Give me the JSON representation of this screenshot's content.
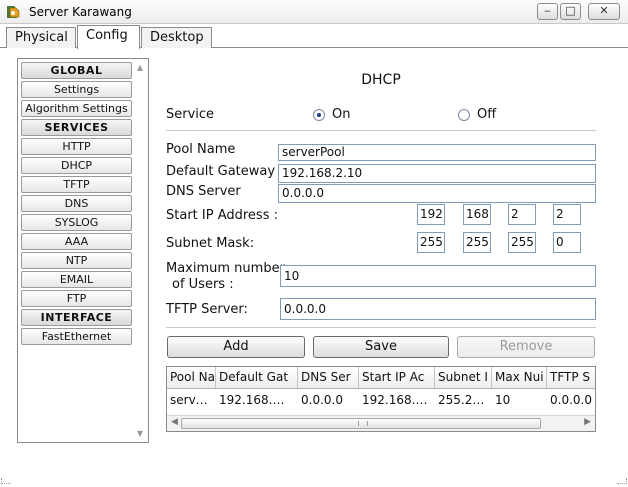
{
  "window": {
    "title": "Server Karawang",
    "icon": "server-app-icon",
    "controls": {
      "minimize": "‒",
      "maximize": "□",
      "close": "✕"
    }
  },
  "tabs": [
    "Physical",
    "Config",
    "Desktop"
  ],
  "active_tab": "Config",
  "sidebar": {
    "items": [
      {
        "label": "GLOBAL",
        "type": "header"
      },
      {
        "label": "Settings",
        "type": "item"
      },
      {
        "label": "Algorithm Settings",
        "type": "item"
      },
      {
        "label": "SERVICES",
        "type": "header"
      },
      {
        "label": "HTTP",
        "type": "item"
      },
      {
        "label": "DHCP",
        "type": "item"
      },
      {
        "label": "TFTP",
        "type": "item"
      },
      {
        "label": "DNS",
        "type": "item"
      },
      {
        "label": "SYSLOG",
        "type": "item"
      },
      {
        "label": "AAA",
        "type": "item"
      },
      {
        "label": "NTP",
        "type": "item"
      },
      {
        "label": "EMAIL",
        "type": "item"
      },
      {
        "label": "FTP",
        "type": "item"
      },
      {
        "label": "INTERFACE",
        "type": "header"
      },
      {
        "label": "FastEthernet",
        "type": "item"
      }
    ]
  },
  "dhcp": {
    "heading": "DHCP",
    "service_label": "Service",
    "on_label": "On",
    "off_label": "Off",
    "service_state": "On",
    "pool_name_label": "Pool Name",
    "pool_name": "serverPool",
    "gateway_label": "Default Gateway",
    "gateway": "192.168.2.10",
    "dns_label": "DNS Server",
    "dns": "0.0.0.0",
    "start_ip_label": "Start IP Address :",
    "start_ip": [
      "192",
      "168",
      "2",
      "2"
    ],
    "subnet_label": "Subnet Mask:",
    "subnet": [
      "255",
      "255",
      "255",
      "0"
    ],
    "max_users_label_1": "Maximum number",
    "max_users_label_2": "of Users :",
    "max_users": "10",
    "tftp_label": "TFTP Server:",
    "tftp": "0.0.0.0",
    "buttons": {
      "add": "Add",
      "save": "Save",
      "remove": "Remove"
    }
  },
  "table": {
    "columns": [
      "Pool Na",
      "Default Gat",
      "DNS Ser",
      "Start IP Ac",
      "Subnet I",
      "Max Nui",
      "TFTP S"
    ],
    "rows": [
      [
        "serv…",
        "192.168.…",
        "0.0.0.0",
        "192.168.…",
        "255.2…",
        "10",
        "0.0.0.0"
      ]
    ]
  }
}
